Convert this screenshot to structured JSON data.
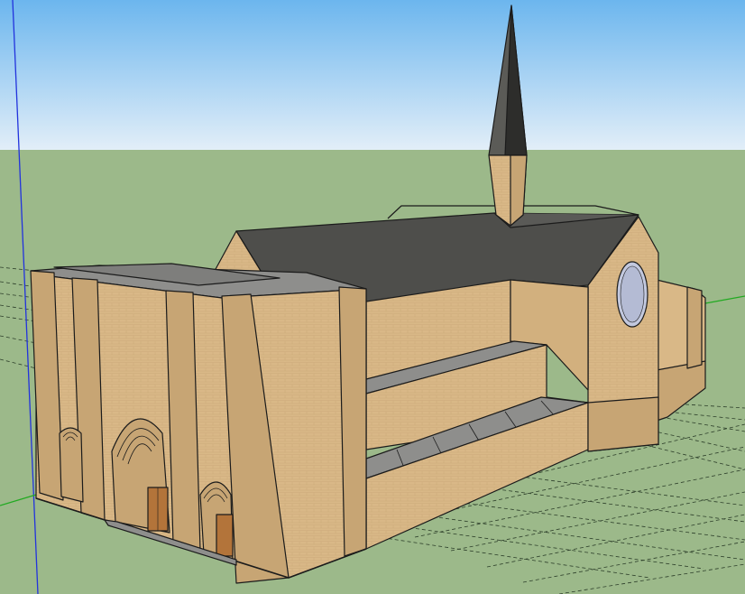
{
  "viewport": {
    "sky_top": "#6cb6ee",
    "sky_bottom": "#e2eef8",
    "ground": "#9cb98a",
    "wall": "#d9b887",
    "wall_shadow": "#c7a574",
    "wall_dark": "#b89562",
    "roof": "#4e4e4b",
    "roof_light": "#6a6a66",
    "ledge": "#8e8e8c",
    "door": "#b3743a",
    "window": "#c2c8de",
    "axis_blue": "#2233dd",
    "axis_green": "#22aa22",
    "axis_red": "#cc2222"
  }
}
